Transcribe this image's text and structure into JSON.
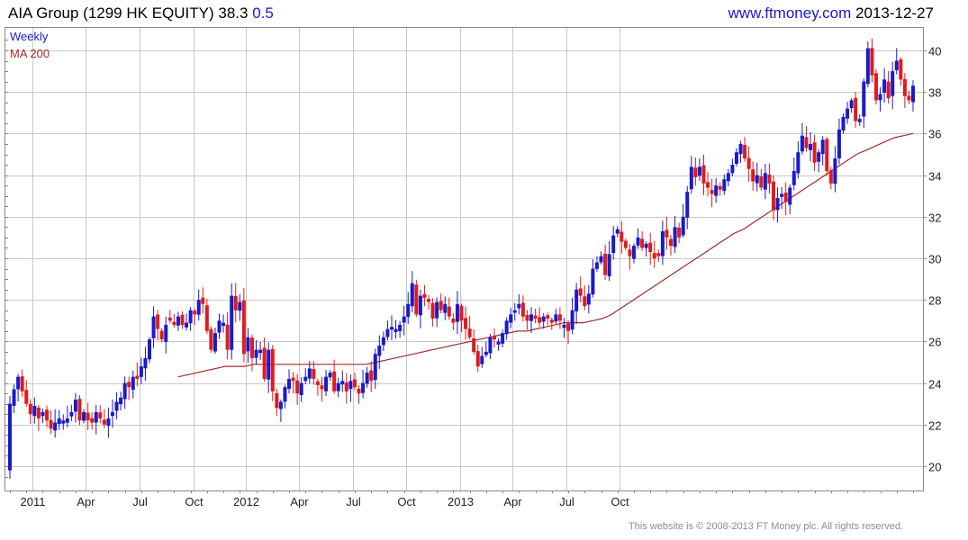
{
  "header": {
    "ticker": "AIA Group (1299 HK EQUITY)",
    "last": "38.3",
    "change": "0.5",
    "site": "www.ftmoney.com",
    "date": "2013-12-27"
  },
  "footer": {
    "copyright": "This website is © 2008-2013 FT Money plc. All rights reserved."
  },
  "colors": {
    "up": "#1a1acc",
    "down": "#e01b1b",
    "ma": "#a52a2a",
    "grid": "#c8c8c8",
    "frame": "#888888"
  },
  "chart_data": {
    "type": "candlestick",
    "title": "AIA Group (1299 HK EQUITY)",
    "legend": [
      "Weekly",
      "MA 200"
    ],
    "legend_position": "top-left",
    "y_axis_side": "right",
    "ylim": [
      19,
      41
    ],
    "y_ticks": [
      "20",
      "22",
      "24",
      "26",
      "28",
      "30",
      "32",
      "34",
      "36",
      "38",
      "40"
    ],
    "x_ticks": [
      "2011",
      "Apr",
      "Jul",
      "Oct",
      "2012",
      "Apr",
      "Jul",
      "Oct",
      "2013",
      "Apr",
      "Jul",
      "Oct"
    ],
    "grid": true,
    "closes": [
      23.0,
      23.7,
      24.3,
      23.6,
      23.0,
      22.5,
      22.9,
      22.3,
      22.6,
      22.2,
      21.8,
      22.1,
      22.3,
      22.2,
      22.3,
      22.6,
      23.2,
      22.2,
      22.6,
      22.2,
      22.1,
      22.6,
      22.3,
      22.0,
      22.3,
      22.6,
      23.1,
      23.3,
      24.0,
      23.8,
      24.3,
      24.2,
      24.8,
      25.2,
      26.1,
      27.2,
      26.6,
      26.1,
      26.8,
      27.0,
      26.8,
      27.2,
      26.8,
      26.9,
      27.5,
      27.3,
      28.0,
      27.8,
      26.5,
      25.6,
      26.4,
      27.0,
      26.9,
      25.6,
      28.2,
      27.5,
      27.9,
      25.4,
      26.2,
      25.2,
      25.6,
      25.6,
      24.2,
      25.6,
      23.6,
      22.8,
      23.1,
      23.8,
      24.2,
      24.1,
      23.5,
      24.0,
      24.3,
      24.7,
      24.2,
      23.9,
      23.7,
      24.3,
      24.5,
      23.6,
      24.0,
      24.1,
      23.6,
      24.1,
      23.8,
      23.5,
      24.0,
      24.5,
      24.1,
      25.4,
      25.8,
      26.2,
      26.6,
      26.7,
      26.6,
      26.8,
      27.2,
      27.8,
      28.8,
      27.3,
      28.2,
      28.1,
      27.9,
      27.1,
      27.9,
      27.5,
      27.8,
      27.2,
      26.9,
      27.8,
      27.0,
      26.6,
      26.2,
      25.5,
      24.8,
      25.3,
      25.5,
      26.2,
      26.1,
      26.0,
      26.4,
      27.0,
      27.3,
      27.5,
      27.8,
      27.2,
      27.0,
      27.3,
      27.1,
      26.9,
      27.2,
      27.1,
      26.9,
      27.3,
      27.0,
      26.8,
      26.5,
      27.5,
      28.5,
      28.2,
      27.7,
      28.3,
      29.5,
      29.8,
      30.1,
      29.2,
      30.2,
      31.1,
      31.4,
      30.8,
      30.5,
      30.1,
      30.6,
      31.0,
      30.5,
      30.7,
      30.3,
      30.0,
      30.1,
      31.3,
      31.0,
      30.6,
      31.5,
      31.0,
      32.0,
      33.2,
      34.4,
      33.9,
      34.4,
      33.6,
      33.4,
      33.1,
      33.5,
      33.3,
      33.8,
      34.1,
      34.5,
      35.1,
      35.5,
      34.8,
      34.3,
      33.7,
      34.0,
      33.4,
      34.1,
      33.6,
      32.3,
      32.9,
      33.1,
      32.7,
      33.4,
      34.2,
      35.1,
      35.9,
      35.3,
      35.5,
      34.6,
      35.1,
      35.7,
      34.2,
      33.6,
      34.8,
      36.2,
      36.8,
      37.2,
      37.6,
      36.6,
      36.7,
      38.5,
      40.1,
      38.8,
      37.6,
      37.9,
      38.6,
      37.7,
      39.0,
      39.5,
      38.6,
      37.8,
      37.6,
      38.3
    ],
    "ma200": [
      24.3,
      24.4,
      24.5,
      24.6,
      24.7,
      24.8,
      24.8,
      24.8,
      24.9,
      24.9,
      24.9,
      24.9,
      24.9,
      24.9,
      24.9,
      24.9,
      24.9,
      24.9,
      24.9,
      24.9,
      24.9,
      25.0,
      25.1,
      25.2,
      25.3,
      25.4,
      25.5,
      25.6,
      25.7,
      25.8,
      25.9,
      26.0,
      26.1,
      26.2,
      26.3,
      26.4,
      26.5,
      26.5,
      26.6,
      26.7,
      26.8,
      26.9,
      26.9,
      26.9,
      27.0,
      27.1,
      27.3,
      27.6,
      27.9,
      28.2,
      28.5,
      28.8,
      29.1,
      29.4,
      29.7,
      30.0,
      30.3,
      30.6,
      30.9,
      31.2,
      31.4,
      31.7,
      32.0,
      32.3,
      32.6,
      32.9,
      33.2,
      33.5,
      33.8,
      34.1,
      34.4,
      34.7,
      35.0,
      35.2,
      35.4,
      35.6,
      35.8,
      35.9,
      36.0
    ]
  }
}
